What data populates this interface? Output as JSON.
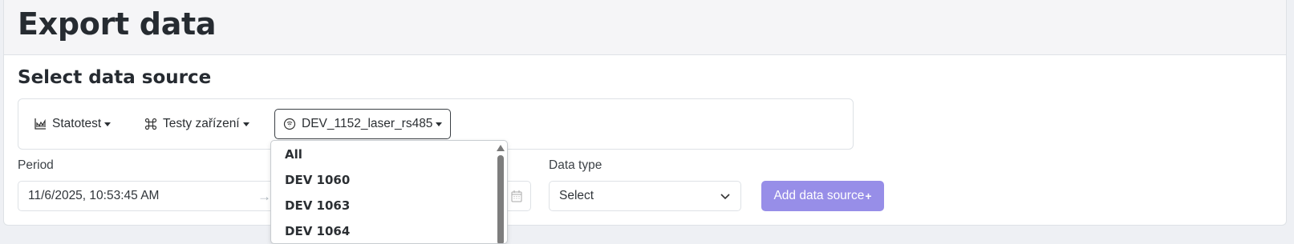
{
  "page": {
    "title": "Export data"
  },
  "section": {
    "title": "Select data source"
  },
  "sources": [
    {
      "label": "Statotest",
      "icon": "chart-icon"
    },
    {
      "label": "Testy zařízení",
      "icon": "command-icon"
    },
    {
      "label": "DEV_1152_laser_rs485",
      "icon": "device-icon",
      "active": true
    }
  ],
  "period": {
    "label": "Period",
    "start": "11/6/2025, 10:53:45 AM"
  },
  "data_type": {
    "label": "Data type",
    "value": "Select"
  },
  "add_button": {
    "label": "Add data source",
    "icon": "+"
  },
  "dropdown": {
    "items": [
      "All",
      "DEV 1060",
      "DEV 1063",
      "DEV 1064"
    ]
  },
  "colors": {
    "accent": "#978ee8",
    "header_bg": "#f5f5f7",
    "border": "#dee2e6"
  }
}
